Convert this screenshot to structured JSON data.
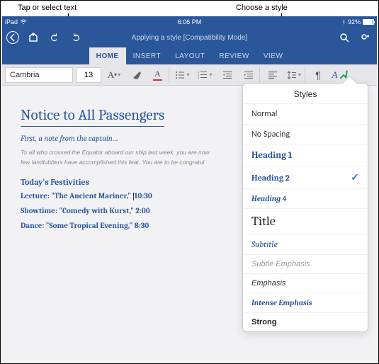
{
  "labels": {
    "tap": "Tap or select text",
    "choose": "Choose a style"
  },
  "status": {
    "device": "iPad",
    "wifi": "᯾",
    "time": "6:06 PM",
    "bt": "92%"
  },
  "title": {
    "doc": "Applying a style [Compatibility Mode]"
  },
  "tabs": {
    "home": "HOME",
    "insert": "INSERT",
    "layout": "LAYOUT",
    "review": "REVIEW",
    "view": "VIEW"
  },
  "toolbar": {
    "font": "Cambria",
    "size": "13"
  },
  "document": {
    "title": "Notice to All Passengers",
    "subnote": "First, a note from the captain…",
    "para1": "To all who crossed the Equator aboard our ship last week, you are now",
    "para2": "few landlubbers have accomplished this feat. You are to be congratul",
    "section": "Today's Festivities",
    "evt1a": "Lecture: \"The Ancient Mariner,\" ",
    "evt1b": "10:30",
    "evt2": "Showtime: \"Comedy with Kurst,\" 2:00",
    "evt3": "Dance: \"Some Tropical Evening,\" 8:30"
  },
  "styles": {
    "title": "Styles",
    "items": {
      "normal": "Normal",
      "nospacing": "No Spacing",
      "h1": "Heading 1",
      "h2": "Heading 2",
      "h4": "Heading 4",
      "title_s": "Title",
      "subtitle": "Subtitle",
      "subtle_emph": "Subtle Emphasis",
      "emph": "Emphasis",
      "intense_emph": "Intense Emphasis",
      "strong": "Strong"
    }
  }
}
